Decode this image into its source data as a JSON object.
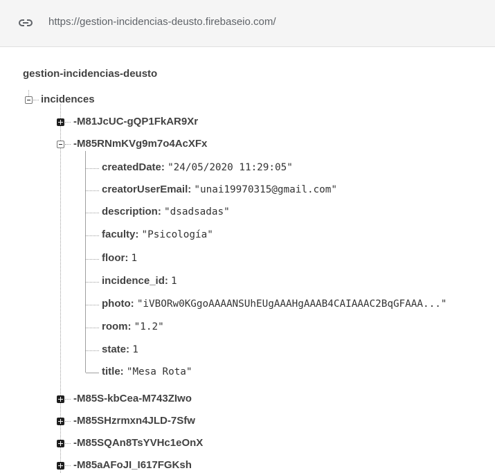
{
  "url_bar": {
    "icon": "link-icon",
    "url": "https://gestion-incidencias-deusto.firebaseio.com/"
  },
  "tree": {
    "root_name": "gestion-incidencias-deusto",
    "collection": {
      "name": "incidences",
      "expanded": true,
      "children": [
        {
          "key": "-M81JcUC-gQP1FkAR9Xr",
          "expanded": false
        },
        {
          "key": "-M85RNmKVg9m7o4AcXFx",
          "expanded": true,
          "fields": [
            {
              "key": "createdDate",
              "value": "\"24/05/2020 11:29:05\""
            },
            {
              "key": "creatorUserEmail",
              "value": "\"unai19970315@gmail.com\""
            },
            {
              "key": "description",
              "value": "\"dsadsadas\""
            },
            {
              "key": "faculty",
              "value": "\"Psicología\""
            },
            {
              "key": "floor",
              "value": "1"
            },
            {
              "key": "incidence_id",
              "value": "1"
            },
            {
              "key": "photo",
              "value": "\"iVBORw0KGgoAAAANSUhEUgAAAHgAAAB4CAIAAAC2BqGFAAA...\""
            },
            {
              "key": "room",
              "value": "\"1.2\""
            },
            {
              "key": "state",
              "value": "1"
            },
            {
              "key": "title",
              "value": "\"Mesa Rota\""
            }
          ]
        },
        {
          "key": "-M85S-kbCea-M743ZIwo",
          "expanded": false
        },
        {
          "key": "-M85SHzrmxn4JLD-7Sfw",
          "expanded": false
        },
        {
          "key": "-M85SQAn8TsYVHc1eOnX",
          "expanded": false
        },
        {
          "key": "-M85aAFoJI_I617FGKsh",
          "expanded": false
        }
      ]
    }
  }
}
